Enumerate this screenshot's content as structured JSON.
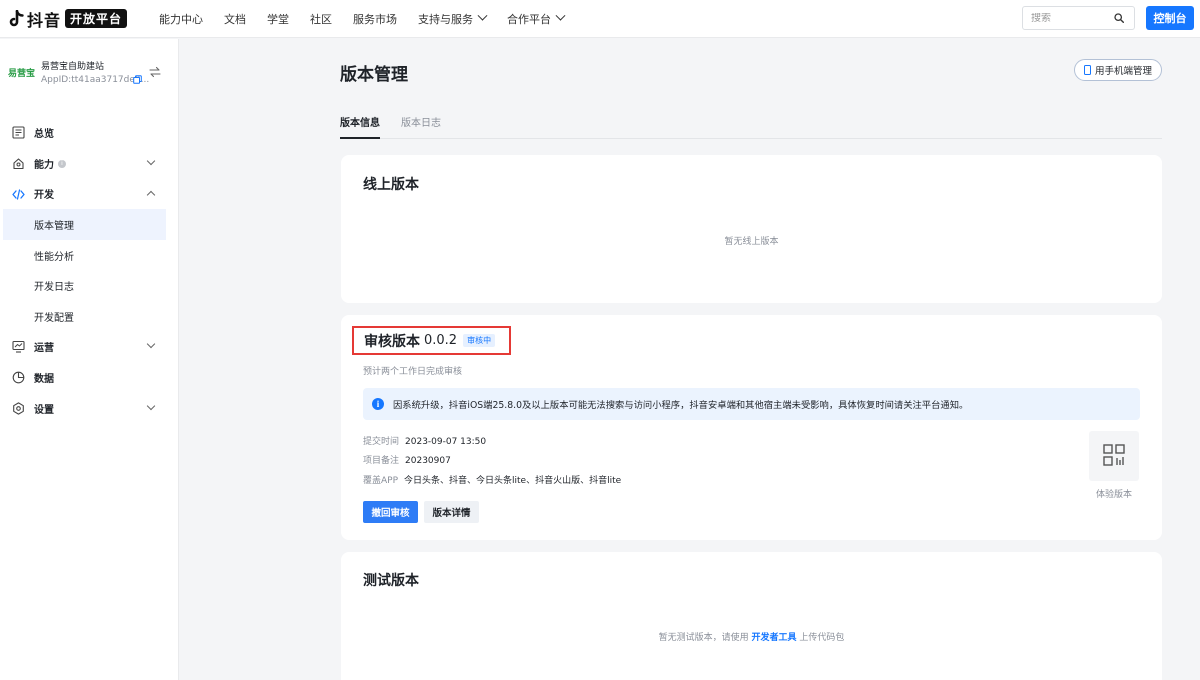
{
  "topnav": {
    "logo_text": "抖音",
    "logo_badge": "开放平台",
    "items": [
      "能力中心",
      "文档",
      "学堂",
      "社区",
      "服务市场",
      "支持与服务",
      "合作平台"
    ],
    "search_placeholder": "搜索",
    "console_label": "控制台"
  },
  "sidebar": {
    "app_logo": "易营宝",
    "app_name": "易营宝自助建站",
    "app_id": "AppID:tt41aa3717de9...",
    "menu": {
      "overview": "总览",
      "capability": "能力",
      "develop": "开发",
      "sub_version": "版本管理",
      "sub_perf": "性能分析",
      "sub_log": "开发日志",
      "sub_config": "开发配置",
      "operation": "运营",
      "data": "数据",
      "settings": "设置"
    }
  },
  "main": {
    "title": "版本管理",
    "mobile_btn": "用手机端管理",
    "tabs": [
      "版本信息",
      "版本日志"
    ],
    "online": {
      "title": "线上版本",
      "empty": "暂无线上版本"
    },
    "review": {
      "title": "审核版本",
      "version": "0.0.2",
      "badge": "审核中",
      "hint": "预计两个工作日完成审核",
      "notice": "因系统升级，抖音iOS端25.8.0及以上版本可能无法搜索与访问小程序，抖音安卓端和其他宿主端未受影响，具体恢复时间请关注平台通知。",
      "submit_time_label": "提交时间",
      "submit_time": "2023-09-07 13:50",
      "note_label": "项目备注",
      "note": "20230907",
      "apps_label": "覆盖APP",
      "apps": "今日头条、抖音、今日头条lite、抖音火山版、抖音lite",
      "qr_label": "体验版本",
      "withdraw_btn": "撤回审核",
      "detail_btn": "版本详情"
    },
    "test": {
      "title": "测试版本",
      "empty_prefix": "暂无测试版本，请使用",
      "empty_link": "开发者工具",
      "empty_suffix": "上传代码包"
    }
  },
  "colors": {
    "accent": "#1677ff",
    "highlight_border": "#e53935",
    "notice_bg": "#ebf3fe"
  }
}
